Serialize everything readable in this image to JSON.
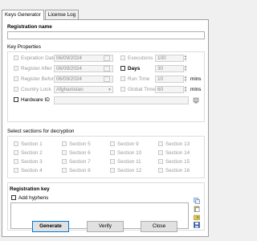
{
  "tabs": [
    "Keys Generator",
    "License Log"
  ],
  "registration_name": {
    "label": "Registration name",
    "value": ""
  },
  "key_properties": {
    "title": "Key Properties",
    "expiration_date": {
      "label": "Expiration Date",
      "value": "06/09/2024"
    },
    "register_after": {
      "label": "Register After",
      "value": "06/09/2024"
    },
    "register_before": {
      "label": "Register Before",
      "value": "06/09/2024"
    },
    "country_lock": {
      "label": "Country Lock",
      "value": "Afghanistan"
    },
    "hardware_id": {
      "label": "Hardware ID",
      "value": ""
    },
    "executions": {
      "label": "Executions",
      "value": "100"
    },
    "days": {
      "label": "Days",
      "value": "30"
    },
    "run_time": {
      "label": "Run Time",
      "value": "10",
      "unit": "mins"
    },
    "global_time": {
      "label": "Global Time",
      "value": "60",
      "unit": "mins"
    }
  },
  "sections": {
    "title": "Select sections for decryption",
    "items": [
      "Section 1",
      "Section 5",
      "Section 9",
      "Section 13",
      "Section 2",
      "Section 6",
      "Section 10",
      "Section 14",
      "Section 3",
      "Section 7",
      "Section 11",
      "Section 15",
      "Section 4",
      "Section 8",
      "Section 12",
      "Section 16"
    ]
  },
  "registration_key": {
    "label": "Registration key",
    "add_hyphens": "Add hyphens",
    "value": ""
  },
  "buttons": {
    "generate": "Generate",
    "verify": "Verify",
    "close": "Close"
  },
  "colors": {
    "accent": "#0078d7",
    "panel_bg": "#ffffff",
    "window_bg": "#f0f0f0"
  },
  "icons": [
    "copy-icon",
    "paste-icon",
    "open-key-icon",
    "save-icon",
    "hardware-id-icon"
  ]
}
